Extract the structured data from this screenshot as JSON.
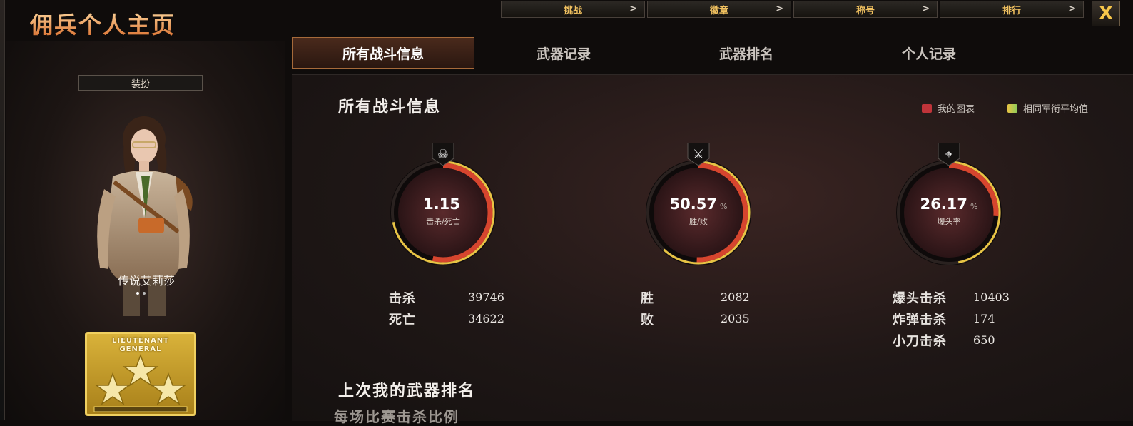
{
  "app": {
    "title": "佣兵个人主页",
    "close_label": "X"
  },
  "top_nav": [
    {
      "label": "挑战",
      "chevron": ">"
    },
    {
      "label": "徽章",
      "chevron": ">"
    },
    {
      "label": "称号",
      "chevron": ">"
    },
    {
      "label": "排行",
      "chevron": ">"
    }
  ],
  "tabs": [
    {
      "label": "所有战斗信息",
      "active": true
    },
    {
      "label": "武器记录",
      "active": false
    },
    {
      "label": "武器排名",
      "active": false
    },
    {
      "label": "个人记录",
      "active": false
    }
  ],
  "left_panel": {
    "outfit_button": "装扮",
    "character_name": "传说艾莉莎",
    "rank": {
      "line1": "LIEUTENANT",
      "line2": "GENERAL",
      "stars": 3
    }
  },
  "section": {
    "title": "所有战斗信息",
    "legend": [
      {
        "label": "我的图表",
        "color": "#c0343a"
      },
      {
        "label": "相同军衔平均值",
        "color": "#e8c444"
      }
    ]
  },
  "gauges": [
    {
      "icon": "skull-crossbones-icon",
      "value": "1.15",
      "unit": "",
      "label": "击杀/死亡",
      "my_fraction": 0.535,
      "avg_fraction": 0.72
    },
    {
      "icon": "crossed-rifles-icon",
      "value": "50.57",
      "unit": "%",
      "label": "胜/败",
      "my_fraction": 0.5057,
      "avg_fraction": 0.62
    },
    {
      "icon": "rifle-scope-icon",
      "value": "26.17",
      "unit": "%",
      "label": "爆头率",
      "my_fraction": 0.2617,
      "avg_fraction": 0.47
    }
  ],
  "stats": {
    "kills_label": "击杀",
    "kills": "39746",
    "deaths_label": "死亡",
    "deaths": "34622",
    "wins_label": "胜",
    "wins": "2082",
    "losses_label": "败",
    "losses": "2035",
    "headshot_label": "爆头击杀",
    "headshot": "10403",
    "bomb_label": "炸弹击杀",
    "bomb": "174",
    "knife_label": "小刀击杀",
    "knife": "650"
  },
  "last_weapon_title": "上次我的武器排名",
  "cut_off_text": "每场比赛击杀比例"
}
